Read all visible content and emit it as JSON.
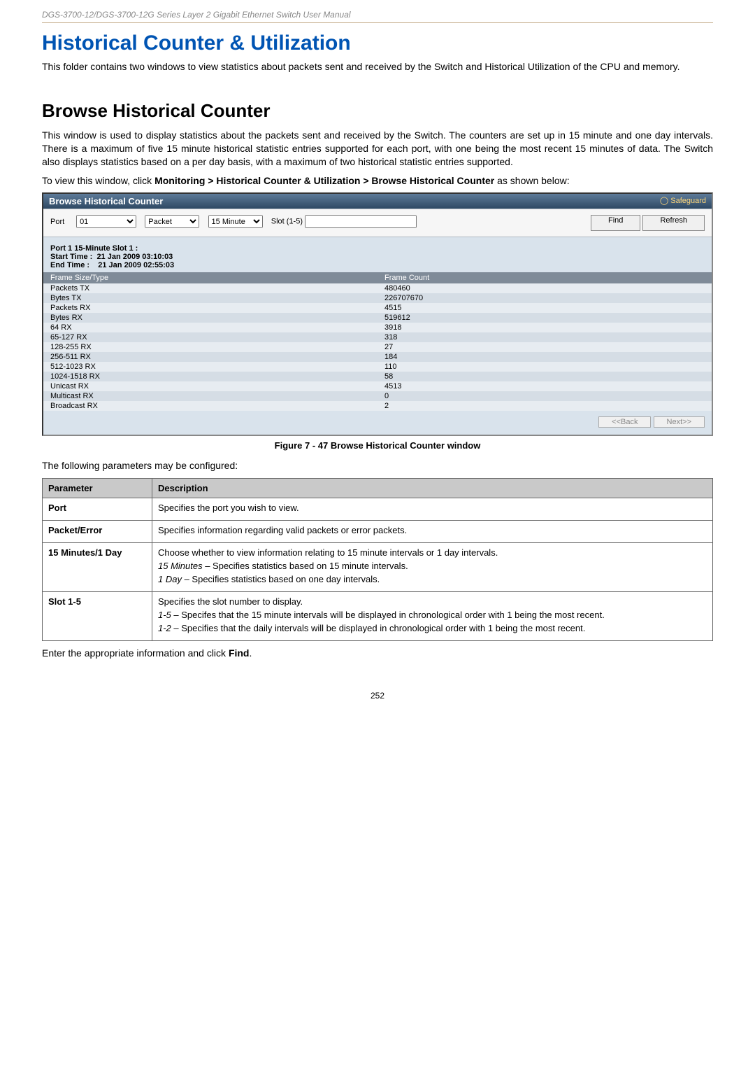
{
  "running_head": "DGS-3700-12/DGS-3700-12G Series Layer 2 Gigabit Ethernet Switch User Manual",
  "h1": "Historical Counter & Utilization",
  "intro1": "This folder contains two windows to view statistics about packets sent and received by the Switch and Historical Utilization of the CPU and memory.",
  "h2": "Browse Historical Counter",
  "intro2": "This window is used to display statistics about the packets sent and received by the Switch. The counters are set up in 15 minute and one day intervals. There is a maximum of five 15 minute historical statistic entries supported for each port, with one being the most recent 15 minutes of data. The Switch also displays statistics based on a per day basis, with a maximum of two historical statistic entries supported.",
  "intro3_pre": "To view this window, click ",
  "intro3_bold": "Monitoring > Historical Counter & Utilization > Browse Historical Counter",
  "intro3_post": " as shown below:",
  "shot": {
    "title": "Browse Historical Counter",
    "safeguard": "Safeguard",
    "toolbar": {
      "port_label": "Port",
      "port_value": "01",
      "packet_value": "Packet",
      "interval_value": "15 Minute",
      "slot_label": "Slot (1-5)",
      "slot_value": "",
      "find_btn": "Find",
      "refresh_btn": "Refresh"
    },
    "labels": {
      "l1a": "Port 1 15-Minute Slot 1 :",
      "l2a": "Start Time :",
      "l2b": "21 Jan 2009 03:10:03",
      "l3a": "End Time :",
      "l3b": "21 Jan 2009 02:55:03"
    },
    "thead": [
      "Frame Size/Type",
      "Frame Count"
    ],
    "rows": [
      [
        "Packets TX",
        "480460"
      ],
      [
        "Bytes TX",
        "226707670"
      ],
      [
        "Packets RX",
        "4515"
      ],
      [
        "Bytes RX",
        "519612"
      ],
      [
        "64 RX",
        "3918"
      ],
      [
        "65-127 RX",
        "318"
      ],
      [
        "128-255 RX",
        "27"
      ],
      [
        "256-511 RX",
        "184"
      ],
      [
        "512-1023 RX",
        "110"
      ],
      [
        "1024-1518 RX",
        "58"
      ],
      [
        "Unicast RX",
        "4513"
      ],
      [
        "Multicast RX",
        "0"
      ],
      [
        "Broadcast RX",
        "2"
      ]
    ],
    "footer": {
      "back": "<<Back",
      "next": "Next>>"
    }
  },
  "caption": "Figure 7 - 47 Browse Historical Counter window",
  "params_intro": "The following parameters may be configured:",
  "ptable": {
    "head": [
      "Parameter",
      "Description"
    ],
    "rows": [
      {
        "name": "Port",
        "lines": [
          {
            "t": "plain",
            "v": "Specifies the port you wish to view."
          }
        ]
      },
      {
        "name": "Packet/Error",
        "lines": [
          {
            "t": "plain",
            "v": "Specifies information regarding valid packets or error packets."
          }
        ]
      },
      {
        "name": "15 Minutes/1 Day",
        "lines": [
          {
            "t": "plain",
            "v": "Choose whether to view information relating to 15 minute intervals or 1 day intervals."
          },
          {
            "t": "italic_lead",
            "i": "15 Minutes",
            "v": " – Specifies statistics based on 15 minute intervals."
          },
          {
            "t": "italic_lead",
            "i": "1 Day",
            "v": " – Specifies statistics based on one day intervals."
          }
        ]
      },
      {
        "name": "Slot 1-5",
        "lines": [
          {
            "t": "plain",
            "v": "Specifies the slot number to display."
          },
          {
            "t": "italic_lead",
            "i": "1-5",
            "v": " – Specifes that the 15 minute intervals will be displayed in chronological order with 1 being the most recent."
          },
          {
            "t": "italic_lead",
            "i": "1-2",
            "v": " – Specifies that the daily intervals will be displayed in chronological order with 1 being the most recent."
          }
        ]
      }
    ]
  },
  "closing_pre": "Enter the appropriate information and click ",
  "closing_bold": "Find",
  "closing_post": ".",
  "page_number": "252"
}
